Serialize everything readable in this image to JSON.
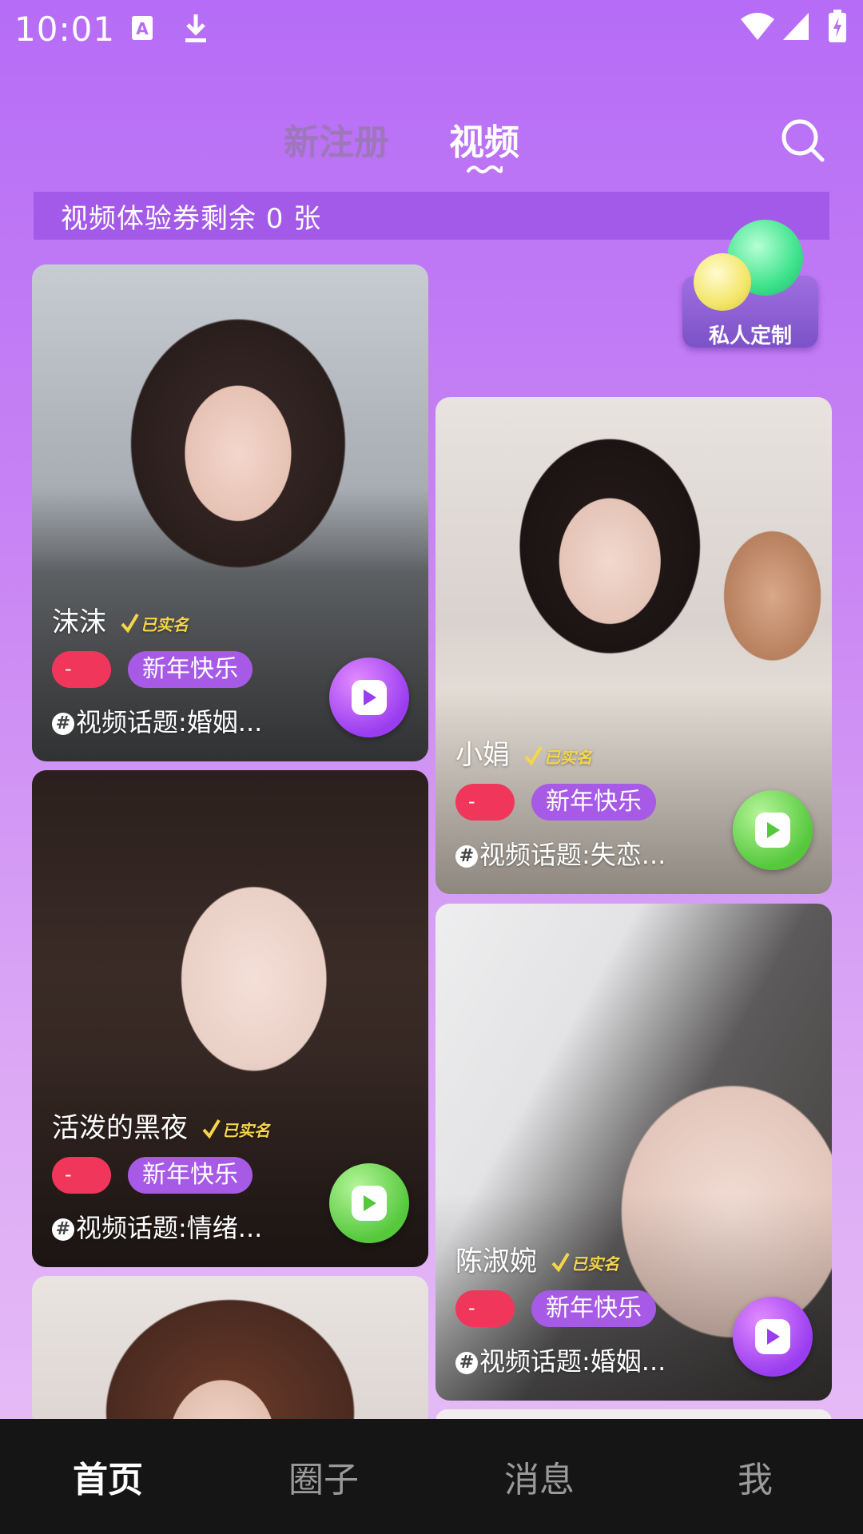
{
  "status_bar": {
    "time": "10:01",
    "icons": [
      "a-notification-icon",
      "download-icon",
      "wifi-icon",
      "signal-icon",
      "battery-icon"
    ]
  },
  "header": {
    "tabs": [
      {
        "label": "新注册",
        "active": false
      },
      {
        "label": "视频",
        "active": true
      }
    ],
    "search_icon": "search-icon"
  },
  "voucher": {
    "text": "视频体验券剩余 0 张"
  },
  "custom_badge": {
    "label": "私人定制"
  },
  "cards": [
    {
      "name": "沫沫",
      "verified_label": "已实名",
      "red_tag": "-",
      "purple_tag": "新年快乐",
      "topic": "视频话题:婚姻...",
      "play_color": "#9a3df0"
    },
    {
      "name": "小娟",
      "verified_label": "已实名",
      "red_tag": "-",
      "purple_tag": "新年快乐",
      "topic": "视频话题:失恋...",
      "play_color": "#55c83c"
    },
    {
      "name": "活泼的黑夜",
      "verified_label": "已实名",
      "red_tag": "-",
      "purple_tag": "新年快乐",
      "topic": "视频话题:情绪...",
      "play_color": "#55c83c"
    },
    {
      "name": "陈淑婉",
      "verified_label": "已实名",
      "red_tag": "-",
      "purple_tag": "新年快乐",
      "topic": "视频话题:婚姻...",
      "play_color": "#9a3df0"
    }
  ],
  "bottom_nav": {
    "items": [
      {
        "label": "首页",
        "active": true
      },
      {
        "label": "圈子",
        "active": false
      },
      {
        "label": "消息",
        "active": false
      },
      {
        "label": "我",
        "active": false
      }
    ]
  },
  "colors": {
    "accent_purple": "#a65ae6",
    "tag_red": "#f0375b",
    "nav_background": "#151515",
    "verified_gold": "#f5d64a"
  }
}
